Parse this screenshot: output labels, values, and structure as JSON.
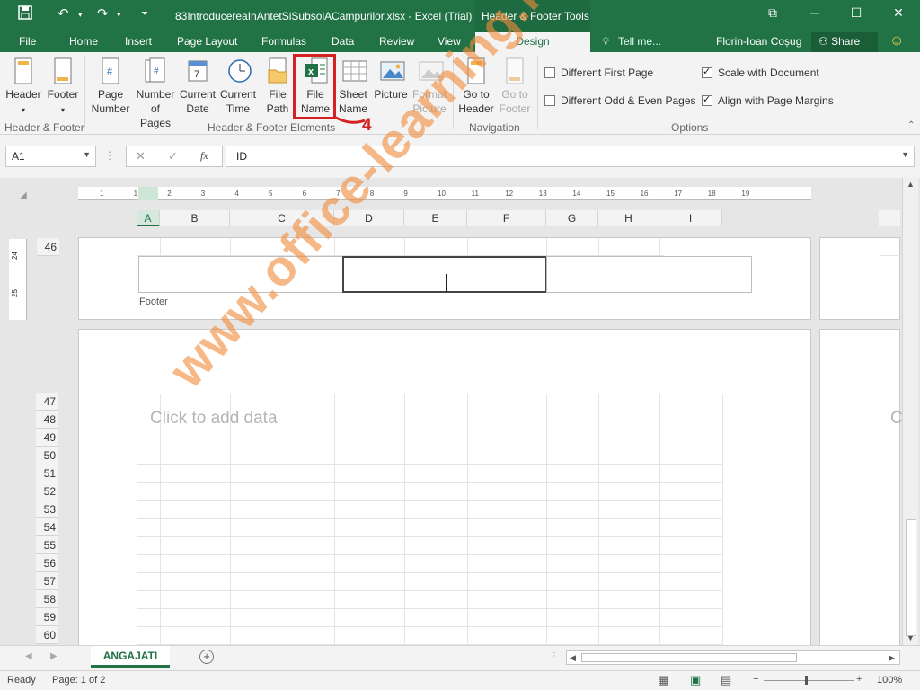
{
  "window": {
    "title": "83IntroducereaInAntetSiSubsolACampurilor.xlsx - Excel (Trial)",
    "contextual_group": "Header & Footer Tools",
    "min_glyph": "─",
    "max_glyph": "☐",
    "close_glyph": "✕",
    "restore_glyph": "⧉"
  },
  "tabs": [
    "File",
    "Home",
    "Insert",
    "Page Layout",
    "Formulas",
    "Data",
    "Review",
    "View"
  ],
  "active_tab": "Design",
  "tell_me": "Tell me...",
  "user": "Florin-Ioan Coșug",
  "share": "Share",
  "ribbon": {
    "hf_group": {
      "header": "Header",
      "footer": "Footer",
      "label": "Header & Footer"
    },
    "elements_group": {
      "page_number": [
        "Page",
        "Number"
      ],
      "number_of_pages": [
        "Number",
        "of Pages"
      ],
      "current_date": [
        "Current",
        "Date"
      ],
      "current_time": [
        "Current",
        "Time"
      ],
      "file_path": [
        "File",
        "Path"
      ],
      "file_name": [
        "File",
        "Name"
      ],
      "sheet_name": [
        "Sheet",
        "Name"
      ],
      "picture": "Picture",
      "format_picture": [
        "Format",
        "Picture"
      ],
      "label": "Header & Footer Elements"
    },
    "nav_group": {
      "go_header": [
        "Go to",
        "Header"
      ],
      "go_footer": [
        "Go to",
        "Footer"
      ],
      "label": "Navigation"
    },
    "options_group": {
      "diff_first": "Different First Page",
      "diff_odd_even": "Different Odd & Even Pages",
      "scale_doc": "Scale with Document",
      "align_margins": "Align with Page Margins",
      "label": "Options"
    }
  },
  "formula_bar": {
    "name_box": "A1",
    "fx": "fx",
    "content": "ID"
  },
  "columns": [
    "A",
    "B",
    "C",
    "D",
    "E",
    "F",
    "G",
    "H",
    "I"
  ],
  "ruler_numbers": [
    "1",
    "1",
    "2",
    "3",
    "4",
    "5",
    "6",
    "7",
    "8",
    "9",
    "10",
    "11",
    "12",
    "13",
    "14",
    "15",
    "16",
    "17",
    "18",
    "19"
  ],
  "v_ruler": [
    "24",
    "25"
  ],
  "footer_label": "Footer",
  "top_row": "46",
  "rows": [
    "47",
    "48",
    "49",
    "50",
    "51",
    "52",
    "53",
    "54",
    "55",
    "56",
    "57",
    "58",
    "59",
    "60"
  ],
  "placeholder": "Click to add data",
  "placeholder_right": "C",
  "sheet_tab": "ANGAJATI",
  "status": {
    "ready": "Ready",
    "page": "Page: 1 of 2",
    "zoom": "100%"
  },
  "annotation": {
    "step": "4",
    "watermark": "www.office-learning.ro"
  }
}
